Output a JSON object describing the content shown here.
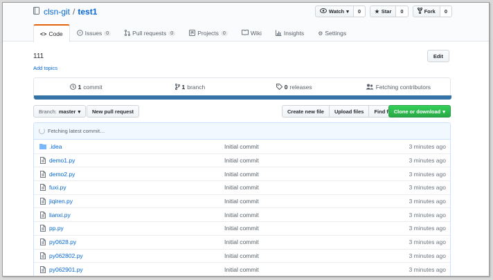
{
  "repo": {
    "owner": "clsn-git",
    "separator": "/",
    "name": "test1"
  },
  "actions": {
    "watch": {
      "label": "Watch",
      "caret": "▾",
      "count": "0"
    },
    "star": {
      "label": "Star",
      "count": "0"
    },
    "fork": {
      "label": "Fork",
      "count": "0"
    }
  },
  "tabs": [
    {
      "label": "Code",
      "icon": "code-icon"
    },
    {
      "label": "Issues",
      "icon": "issue-icon",
      "count": "0"
    },
    {
      "label": "Pull requests",
      "icon": "pull-request-icon",
      "count": "0"
    },
    {
      "label": "Projects",
      "icon": "project-icon",
      "count": "0"
    },
    {
      "label": "Wiki",
      "icon": "book-icon"
    },
    {
      "label": "Insights",
      "icon": "graph-icon"
    },
    {
      "label": "Settings",
      "icon": "gear-icon"
    }
  ],
  "description": "111",
  "add_topics": "Add topics",
  "edit_label": "Edit",
  "summary": {
    "commits": {
      "num": "1",
      "label": "commit",
      "icon": "history-icon"
    },
    "branches": {
      "num": "1",
      "label": "branch",
      "icon": "branch-icon"
    },
    "releases": {
      "num": "0",
      "label": "releases",
      "icon": "tag-icon"
    },
    "contributors": {
      "label": "Fetching contributors",
      "icon": "people-icon"
    }
  },
  "language_color": "#3572a5",
  "filenav": {
    "branch_prefix": "Branch:",
    "branch_name": "master",
    "new_pr": "New pull request",
    "create_file": "Create new file",
    "upload_files": "Upload files",
    "find_file": "Find file",
    "clone": "Clone or download"
  },
  "commit_tease": "Fetching latest commit…",
  "files": [
    {
      "type": "dir",
      "name": ".idea",
      "message": "Initial commit",
      "age": "3 minutes ago"
    },
    {
      "type": "file",
      "name": "demo1.py",
      "message": "Initial commit",
      "age": "3 minutes ago"
    },
    {
      "type": "file",
      "name": "demo2.py",
      "message": "Initial commit",
      "age": "3 minutes ago"
    },
    {
      "type": "file",
      "name": "fuxi.py",
      "message": "Initial commit",
      "age": "3 minutes ago"
    },
    {
      "type": "file",
      "name": "jiqiren.py",
      "message": "Initial commit",
      "age": "3 minutes ago"
    },
    {
      "type": "file",
      "name": "lianxi.py",
      "message": "Initial commit",
      "age": "3 minutes ago"
    },
    {
      "type": "file",
      "name": "pp.py",
      "message": "Initial commit",
      "age": "3 minutes ago"
    },
    {
      "type": "file",
      "name": "py0628.py",
      "message": "Initial commit",
      "age": "3 minutes ago"
    },
    {
      "type": "file",
      "name": "py062802.py",
      "message": "Initial commit",
      "age": "3 minutes ago"
    },
    {
      "type": "file",
      "name": "py062901.py",
      "message": "Initial commit",
      "age": "3 minutes ago"
    }
  ]
}
